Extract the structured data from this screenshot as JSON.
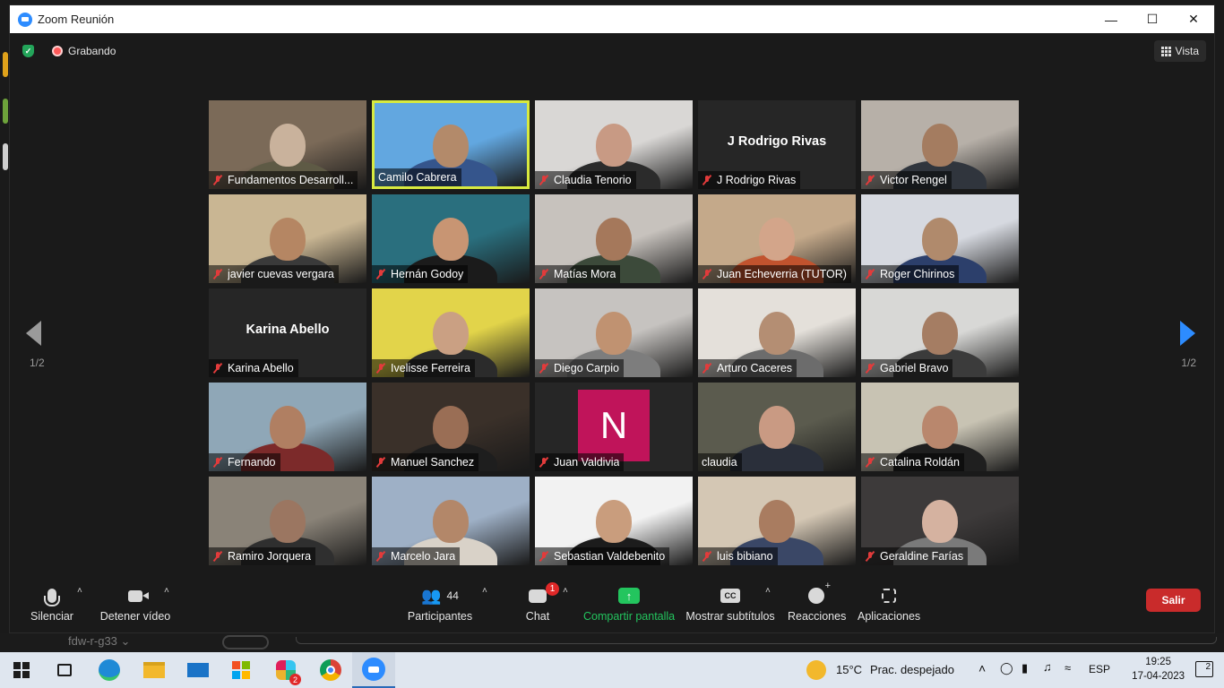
{
  "window": {
    "title": "Zoom Reunión",
    "controls": [
      "minimize",
      "maximize",
      "close"
    ]
  },
  "topbar": {
    "recording_label": "Grabando",
    "view_label": "Vista"
  },
  "pagination": {
    "left": "1/2",
    "right": "1/2"
  },
  "participants": [
    {
      "name": "Fundamentos Desarroll...",
      "muted": true,
      "video": true,
      "colors": [
        "#7b6a58",
        "#c9b29c",
        "#5e5a45"
      ]
    },
    {
      "name": "Camilo Cabrera",
      "muted": false,
      "video": true,
      "active": true,
      "colors": [
        "#62a7e0",
        "#b38a6a",
        "#35558c"
      ]
    },
    {
      "name": "Claudia Tenorio",
      "muted": true,
      "video": true,
      "colors": [
        "#d9d7d5",
        "#c89a84",
        "#2b2b2b"
      ]
    },
    {
      "name": "J Rodrigo Rivas",
      "muted": true,
      "video": false,
      "display_name": "J Rodrigo Rivas"
    },
    {
      "name": "Victor Rengel",
      "muted": true,
      "video": true,
      "colors": [
        "#b7b0a8",
        "#a47c60",
        "#30353d"
      ]
    },
    {
      "name": "javier cuevas vergara",
      "muted": true,
      "video": true,
      "colors": [
        "#c9b693",
        "#b58663",
        "#3a3a3a"
      ]
    },
    {
      "name": "Hernán Godoy",
      "muted": true,
      "video": true,
      "colors": [
        "#2a6f7e",
        "#c89573",
        "#1b1b1b"
      ]
    },
    {
      "name": "Matías Mora",
      "muted": true,
      "video": true,
      "colors": [
        "#c7c2bd",
        "#a5785b",
        "#3c4a3a"
      ]
    },
    {
      "name": "Juan Echeverria (TUTOR)",
      "muted": true,
      "video": true,
      "colors": [
        "#c4a98a",
        "#d3a58a",
        "#c1532e"
      ]
    },
    {
      "name": "Roger Chirinos",
      "muted": true,
      "video": true,
      "colors": [
        "#d6d9e0",
        "#b08a6c",
        "#2c3f6b"
      ]
    },
    {
      "name": "Karina Abello",
      "muted": true,
      "video": false,
      "display_name": "Karina Abello"
    },
    {
      "name": "Ivelisse Ferreira",
      "muted": true,
      "video": true,
      "colors": [
        "#e2d44a",
        "#caa083",
        "#2b2b2b"
      ]
    },
    {
      "name": "Diego Carpio",
      "muted": true,
      "video": true,
      "colors": [
        "#c6c3c0",
        "#c09271",
        "#7d7d7d"
      ]
    },
    {
      "name": "Arturo Caceres",
      "muted": true,
      "video": true,
      "colors": [
        "#e4e0da",
        "#b48e73",
        "#6c6c6c"
      ]
    },
    {
      "name": "Gabriel Bravo",
      "muted": true,
      "video": true,
      "colors": [
        "#d8d8d6",
        "#a57d63",
        "#3b3b3b"
      ]
    },
    {
      "name": "Fernando",
      "muted": true,
      "video": true,
      "colors": [
        "#8fa7b7",
        "#b07f62",
        "#7c2a2a"
      ]
    },
    {
      "name": "Manuel Sanchez",
      "muted": true,
      "video": true,
      "colors": [
        "#3a3029",
        "#9a6e55",
        "#1e1e1e"
      ]
    },
    {
      "name": "Juan Valdivia",
      "muted": true,
      "video": false,
      "avatar_letter": "N",
      "avatar_color": "#c0145a"
    },
    {
      "name": "claudia",
      "muted": false,
      "video": true,
      "colors": [
        "#5b5b4e",
        "#c99a83",
        "#2a2f3a"
      ]
    },
    {
      "name": "Catalina Roldán",
      "muted": true,
      "video": true,
      "colors": [
        "#c8c3b3",
        "#b9876d",
        "#1f1f1f"
      ]
    },
    {
      "name": "Ramiro Jorquera",
      "muted": true,
      "video": true,
      "colors": [
        "#8a8378",
        "#9b7661",
        "#2f2f2f"
      ]
    },
    {
      "name": "Marcelo Jara",
      "muted": true,
      "video": true,
      "colors": [
        "#9eb0c6",
        "#b38769",
        "#d9d2c8"
      ]
    },
    {
      "name": "Sebastian Valdebenito",
      "muted": true,
      "video": true,
      "colors": [
        "#f2f2f2",
        "#c99d7d",
        "#1c1c1c"
      ]
    },
    {
      "name": "luis bibiano",
      "muted": true,
      "video": true,
      "colors": [
        "#d4c7b4",
        "#a97c60",
        "#3a4766"
      ]
    },
    {
      "name": "Geraldine Farías",
      "muted": true,
      "video": true,
      "colors": [
        "#3d3a3a",
        "#d5b2a0",
        "#7a7a7a"
      ]
    }
  ],
  "toolbar": {
    "mute_label": "Silenciar",
    "video_label": "Detener vídeo",
    "participants_label": "Participantes",
    "participants_count": "44",
    "chat_label": "Chat",
    "chat_badge": "1",
    "share_label": "Compartir pantalla",
    "captions_label": "Mostrar subtítulos",
    "captions_icon_text": "CC",
    "reactions_label": "Reacciones",
    "apps_label": "Aplicaciones",
    "leave_label": "Salir",
    "share_color": "#23c55e",
    "leave_color": "#c92b2b"
  },
  "behind_window": {
    "text": "fdw-r-g33 ⌄"
  },
  "taskbar": {
    "weather_temp": "15°C",
    "weather_desc": "Prac. despejado",
    "language": "ESP",
    "time": "19:25",
    "date": "17-04-2023",
    "notifications": "2",
    "slack_badge": "2"
  }
}
